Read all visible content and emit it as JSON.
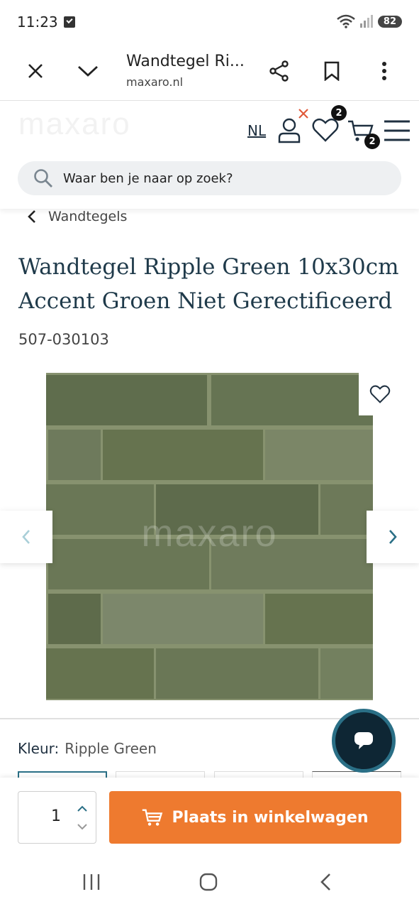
{
  "status": {
    "time": "11:23",
    "battery": "82",
    "network_label": "6"
  },
  "browser": {
    "page_title": "Wandtegel Ri...",
    "url": "maxaro.nl"
  },
  "header": {
    "logo_text": "maxaro",
    "lang": "NL",
    "wishlist_count": "2",
    "cart_count": "2",
    "search_placeholder": "Waar ben je naar op zoek?"
  },
  "breadcrumb": {
    "label": "Wandtegels"
  },
  "product": {
    "title": "Wandtegel Ripple Green 10x30cm Accent Groen Niet Gerectificeerd",
    "sku": "507-030103",
    "watermark": "maxaro",
    "color_label": "Kleur:",
    "color_value": "Ripple Green"
  },
  "cart": {
    "quantity": "1",
    "add_label": "Plaats in winkelwagen"
  },
  "colors": {
    "accent": "#ee7a2f",
    "text": "#1f3a4a",
    "tile": "#6d7a5a",
    "chat": "#0e2634"
  }
}
